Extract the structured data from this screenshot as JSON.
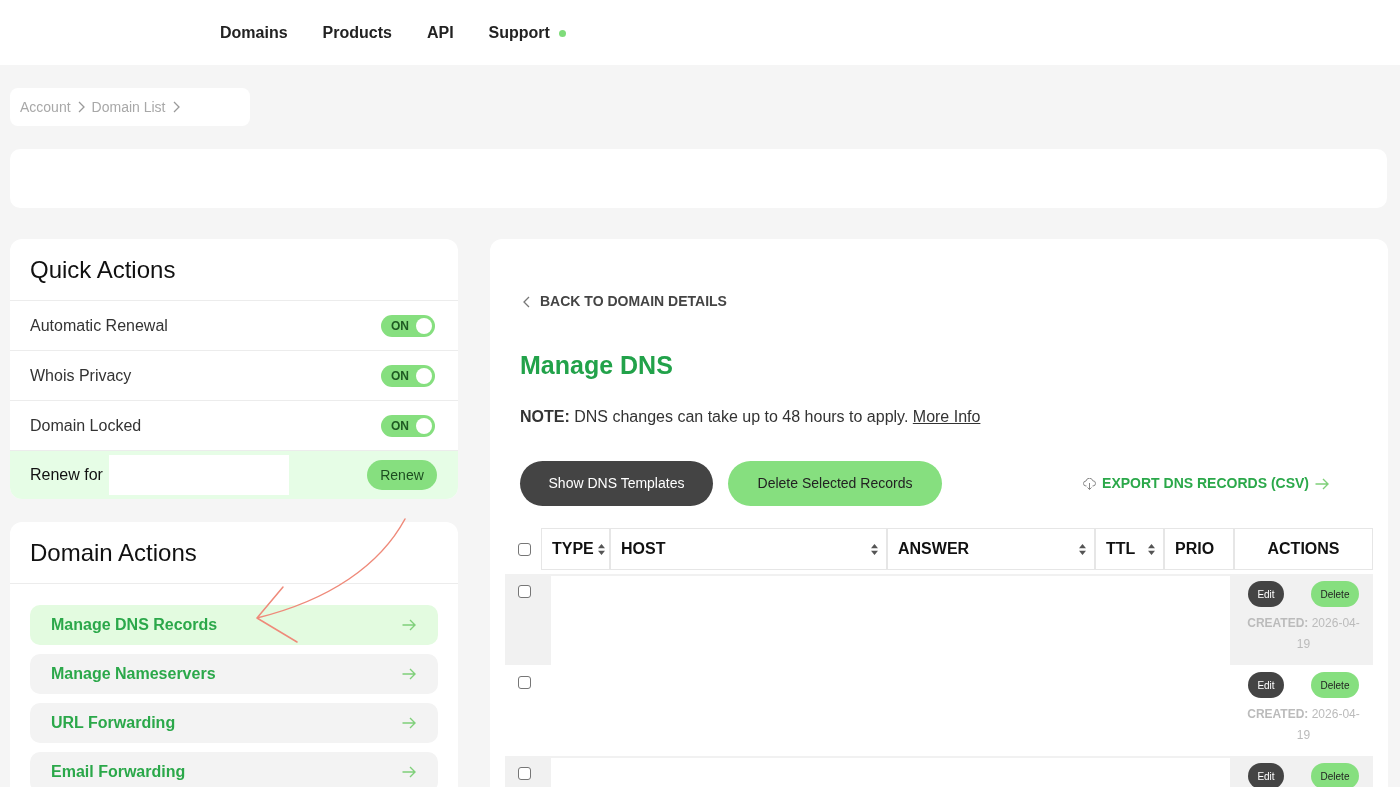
{
  "nav": {
    "items": [
      {
        "label": "Domains",
        "dot": false
      },
      {
        "label": "Products",
        "dot": false
      },
      {
        "label": "API",
        "dot": false
      },
      {
        "label": "Support",
        "dot": true
      }
    ]
  },
  "breadcrumb": [
    "Account",
    "Domain List"
  ],
  "quick_actions": {
    "title": "Quick Actions",
    "toggles": [
      {
        "label": "Automatic Renewal",
        "on": true,
        "state_label": "ON"
      },
      {
        "label": "Whois Privacy",
        "on": true,
        "state_label": "ON"
      },
      {
        "label": "Domain Locked",
        "on": true,
        "state_label": "ON"
      }
    ],
    "renew": {
      "label": "Renew for",
      "button": "Renew"
    }
  },
  "domain_actions": {
    "title": "Domain Actions",
    "items": [
      {
        "label": "Manage DNS Records",
        "selected": true
      },
      {
        "label": "Manage Nameservers",
        "selected": false
      },
      {
        "label": "URL Forwarding",
        "selected": false
      },
      {
        "label": "Email Forwarding",
        "selected": false
      }
    ]
  },
  "dns": {
    "back_link": "BACK TO DOMAIN DETAILS",
    "title": "Manage DNS",
    "note": "**NOTE:** DNS changes can take up to 48 hours to apply.",
    "note_link": "More Info",
    "buttons": [
      {
        "label": "Show DNS Templates",
        "kind": "dark"
      },
      {
        "label": "Delete Selected Records",
        "kind": "green"
      }
    ],
    "export_link": "EXPORT DNS RECORDS (CSV)",
    "table": {
      "select_all_checked": false,
      "columns": [
        {
          "label": "TYPE",
          "sortable": true
        },
        {
          "label": "HOST",
          "sortable": true
        },
        {
          "label": "ANSWER",
          "sortable": true
        },
        {
          "label": "TTL",
          "sortable": true
        },
        {
          "label": "PRIO",
          "sortable": false
        },
        {
          "label": "ACTIONS",
          "sortable": false
        }
      ],
      "rows": [
        {
          "checked": false,
          "edit": "Edit",
          "delete": "Delete",
          "created": "**CREATED:** 2026-04-19"
        },
        {
          "checked": false,
          "edit": "Edit",
          "delete": "Delete",
          "created": "**CREATED:** 2026-04-19"
        },
        {
          "checked": false,
          "edit": "Edit",
          "delete": "Delete"
        }
      ]
    }
  }
}
